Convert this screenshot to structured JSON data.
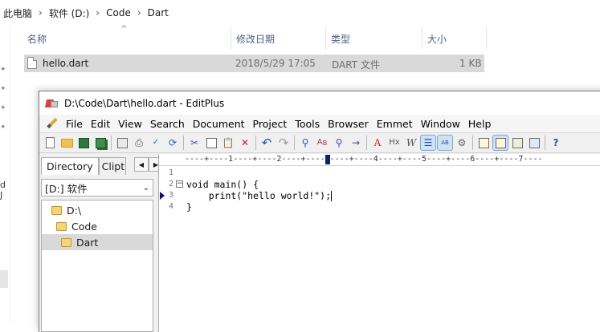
{
  "explorer": {
    "breadcrumb": [
      "此电脑",
      "软件 (D:)",
      "Code",
      "Dart"
    ],
    "columns": {
      "name": "名称",
      "modified": "修改日期",
      "type": "类型",
      "size": "大小"
    },
    "files": [
      {
        "name": "hello.dart",
        "modified": "2018/5/29 17:05",
        "type": "DART 文件",
        "size": "1 KB"
      }
    ],
    "nav_cut_text": "d J"
  },
  "editplus": {
    "title": "D:\\Code\\Dart\\hello.dart - EditPlus",
    "menus": [
      "File",
      "Edit",
      "View",
      "Search",
      "Document",
      "Project",
      "Tools",
      "Browser",
      "Emmet",
      "Window",
      "Help"
    ],
    "panel": {
      "tabs": [
        "Directory",
        "Clipt"
      ],
      "drive": "[D:] 软件",
      "tree": [
        "D:\\",
        "Code",
        "Dart"
      ]
    },
    "ruler": "----+----1----+----2----+----3----+----4----+----5----+----6----+----7----",
    "line_numbers": [
      "1",
      "2",
      "3",
      "4"
    ],
    "code_lines": [
      "",
      "void main() {",
      "    print(\"hello world!\");",
      "}"
    ]
  },
  "colors": {
    "selection_row": "#d9d9d9",
    "column_header_text": "#4d6082",
    "current_line_marker": "#10106a"
  }
}
